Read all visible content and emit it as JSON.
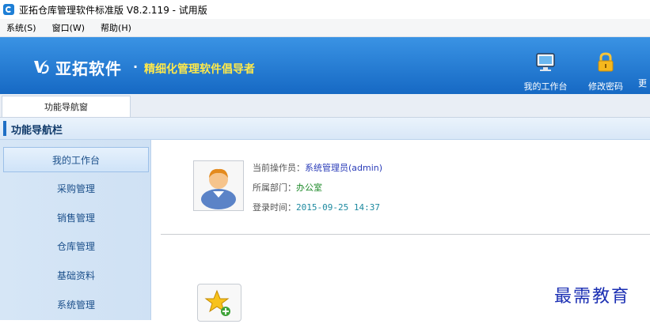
{
  "window": {
    "title": "亚拓仓库管理软件标准版 V8.2.119 - 试用版"
  },
  "menubar": {
    "items": [
      "系统(S)",
      "窗口(W)",
      "帮助(H)"
    ]
  },
  "banner": {
    "brand_name": "亚拓软件",
    "dot": "·",
    "slogan": "精细化管理软件倡导者",
    "tools": [
      {
        "label": "我的工作台",
        "icon": "monitor-icon"
      },
      {
        "label": "修改密码",
        "icon": "lock-icon"
      },
      {
        "label": "更",
        "icon": "partial-icon"
      }
    ]
  },
  "tabs": [
    {
      "label": "功能导航窗"
    }
  ],
  "nav": {
    "header": "功能导航栏",
    "items": [
      "我的工作台",
      "采购管理",
      "销售管理",
      "仓库管理",
      "基础资料",
      "系统管理"
    ],
    "active_index": 0
  },
  "profile": {
    "operator_label": "当前操作员：",
    "operator_value": "系统管理员(admin)",
    "dept_label": "所属部门：",
    "dept_value": "办公室",
    "login_label": "登录时间：",
    "login_value": "2015-09-25 14:37"
  },
  "watermark": "最需教育",
  "colors": {
    "banner": "#1f7ad3",
    "slogan": "#ffe94a",
    "nav_text": "#1b4f8a"
  }
}
